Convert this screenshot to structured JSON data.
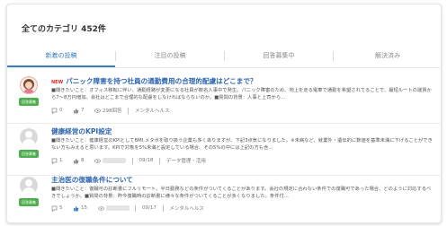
{
  "header": {
    "title": "全てのカテゴリ 452件"
  },
  "tabs": [
    {
      "label": "新着の投稿",
      "active": true
    },
    {
      "label": "注目の投稿",
      "active": false
    },
    {
      "label": "回答募集中",
      "active": false
    },
    {
      "label": "解決済み",
      "active": false
    }
  ],
  "posts": [
    {
      "new_label": "NEW",
      "title": "パニック障害を持つ社員の通勤費用の合理的配慮はどこまで？",
      "excerpt": "■聞きたいこと：オフィス移転に伴い、通勤経路が変更になる社員が数名入事中で発生。パニック障害のため、地上を走る電車で通勤を希望されてることで、最短ルートの運賃から7〜8万円増加。会社はどこまで合理的な配慮をしなければならないのか。■質問の背景：人事と上司から…",
      "badge": "回答募集",
      "comments": "0",
      "likes": "7",
      "views": "298回答",
      "category": "メンタルヘルス",
      "accent": "#2f66b0"
    },
    {
      "new_label": "",
      "title": "健康経営のKPI設定",
      "excerpt": "■聞きたいこと：健康経営のKPIとしてBMI,メタボを取り扱う企業も多くありますが、下記3点気になりました。※未病など、就業外・遺伝的に数値を基準未満に下げることができない方もみえると思います。KPIで対象を5%未満と設定している場合、その5%の中には上記の方も含…",
      "badge": "回答募集",
      "comments": "1",
      "likes": "8",
      "views": "",
      "date": "09/18",
      "category": "データ管理・活用"
    },
    {
      "new_label": "",
      "title": "主治医の復職条件について",
      "excerpt": "■聞きたいこと：復職可の診断書にフルリモート、半日勤務などの条件がついてくることがあります。会社の規定に合わない条件での復職可であった場合、どのように対応するべきでしょうか。■質問の背景：昨今復職時の診断書に様々な条件がついてくることが多くなりました。条件付…",
      "badge": "回答募集",
      "comments": "5",
      "likes": "15",
      "views": "",
      "date": "09/17",
      "category": "メンタルヘルス"
    }
  ],
  "colors": {
    "link": "#2f66b0",
    "tab_active": "#3a7fc0",
    "badge_green": "#4cae4c",
    "new_red": "#e0281f"
  },
  "icons": {
    "comment": "speech-bubble-icon",
    "like": "thumbs-up-icon",
    "views": "eye-icon",
    "category": "folder-icon"
  }
}
